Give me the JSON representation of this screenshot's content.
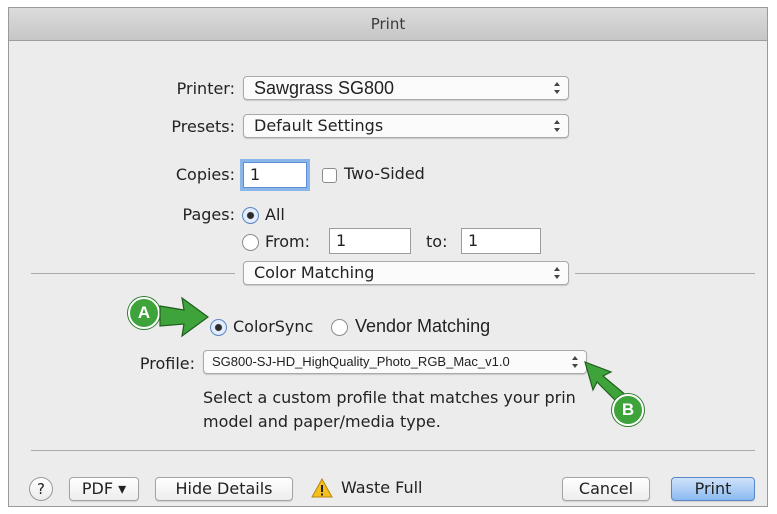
{
  "window": {
    "title": "Print"
  },
  "printer": {
    "label": "Printer:",
    "value": "Sawgrass SG800"
  },
  "presets": {
    "label": "Presets:",
    "value": "Default Settings"
  },
  "copies": {
    "label": "Copies:",
    "value": "1",
    "two_sided_label": "Two-Sided"
  },
  "pages": {
    "label": "Pages:",
    "all_label": "All",
    "from_label": "From:",
    "from_value": "1",
    "to_label": "to:",
    "to_value": "1"
  },
  "section": {
    "value": "Color Matching"
  },
  "color_matching": {
    "colorsync_label": "ColorSync",
    "vendor_label": "Vendor Matching",
    "selected": "ColorSync",
    "profile_label": "Profile:",
    "profile_value": "SG800-SJ-HD_HighQuality_Photo_RGB_Mac_v1.0",
    "description_line1": "Select a custom profile that matches your prin",
    "description_line2": "model and paper/media type."
  },
  "footer": {
    "help": "?",
    "pdf_label": "PDF ▾",
    "hide_details_label": "Hide Details",
    "warning_text": "Waste Full",
    "cancel_label": "Cancel",
    "print_label": "Print"
  },
  "callouts": {
    "a": "A",
    "b": "B",
    "color": "#3fa33c"
  }
}
